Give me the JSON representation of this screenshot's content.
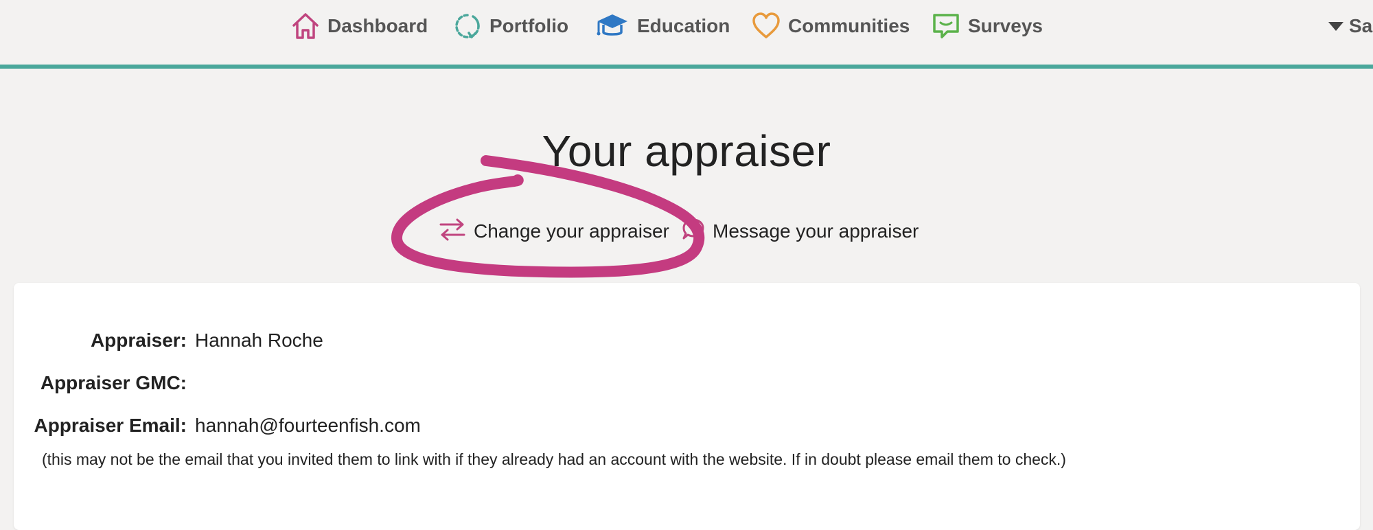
{
  "nav": {
    "items": [
      {
        "label": "Dashboard",
        "icon": "home-icon",
        "color": "#c0457f"
      },
      {
        "label": "Portfolio",
        "icon": "refresh-icon",
        "color": "#4aa79b"
      },
      {
        "label": "Education",
        "icon": "graduation-cap-icon",
        "color": "#2f78c4"
      },
      {
        "label": "Communities",
        "icon": "heart-icon",
        "color": "#e89a3c"
      },
      {
        "label": "Surveys",
        "icon": "chat-icon",
        "color": "#5bb24a"
      }
    ],
    "user_label": "Sa",
    "accent_color": "#4aa79b"
  },
  "page": {
    "title": "Your appraiser"
  },
  "actions": {
    "change_label": "Change your appraiser",
    "change_icon": "swap-arrows-icon",
    "message_label": "Message your appraiser",
    "message_icon": "speech-bubble-icon",
    "icon_color": "#c0457f"
  },
  "details": {
    "appraiser_label": "Appraiser:",
    "appraiser_value": "Hannah Roche",
    "gmc_label": "Appraiser GMC:",
    "gmc_value": "",
    "email_label": "Appraiser Email:",
    "email_value": "hannah@fourteenfish.com",
    "note": "(this may not be the email that you invited them to link with if they already had an account with the website. If in doubt please email them to check.)"
  },
  "annotation": {
    "type": "hand-drawn circle",
    "color": "#c43b80"
  }
}
